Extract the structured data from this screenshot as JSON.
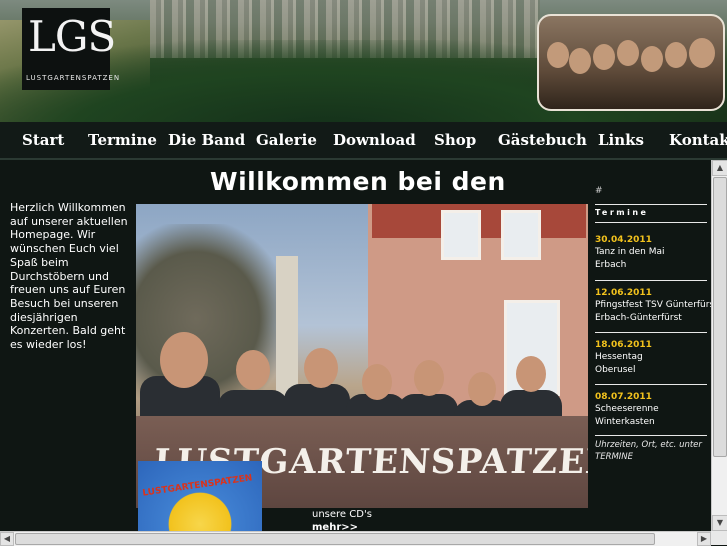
{
  "header": {
    "logo_text": "LGS",
    "logo_subtext": "LUSTGARTENSPATZEN"
  },
  "nav": {
    "items": [
      {
        "label": "Start"
      },
      {
        "label": "Termine"
      },
      {
        "label": "Die Band"
      },
      {
        "label": "Galerie"
      },
      {
        "label": "Download"
      },
      {
        "label": "Shop"
      },
      {
        "label": "Gästebuch"
      },
      {
        "label": "Links"
      },
      {
        "label": "Kontakt"
      }
    ]
  },
  "main": {
    "title": "Willkommen bei den",
    "welcome_text": "Herzlich Willkommen auf unserer aktuellen Homepage. Wir wünschen Euch viel Spaß beim Durchstöbern und freuen uns auf Euren Besuch bei unseren diesjährigen Konzerten. Bald geht es wieder los!",
    "photo_banner": "LUSTGARTENSPATZEN",
    "cd_text": "unsere CD's",
    "cd_more": "mehr>>"
  },
  "sidebar": {
    "hash": "#",
    "heading": "Termine",
    "events": [
      {
        "date": "30.04.2011",
        "line1": "Tanz in den Mai",
        "line2": "Erbach"
      },
      {
        "date": "12.06.2011",
        "line1": "Pfingstfest TSV Günterfürst",
        "line2": "Erbach-Günterfürst"
      },
      {
        "date": "18.06.2011",
        "line1": "Hessentag",
        "line2": "Oberusel"
      },
      {
        "date": "08.07.2011",
        "line1": "Scheeserenne",
        "line2": "Winterkasten"
      }
    ],
    "note": "Uhrzeiten, Ort, etc. unter TERMINE"
  },
  "colors": {
    "background": "#0f1613",
    "accent_date": "#f2c21d",
    "text": "#ffffff"
  }
}
